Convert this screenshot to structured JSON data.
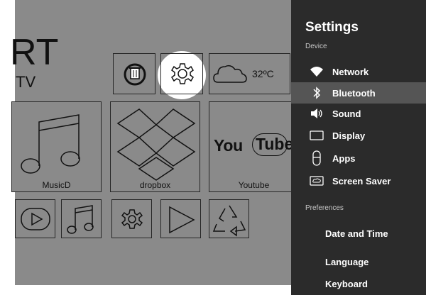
{
  "home": {
    "brand_line1": "RT",
    "brand_line2": "TV",
    "weather_temp": "32ºC",
    "tiles": {
      "music_label": "MusicD",
      "dropbox_label": "dropbox",
      "youtube_label": "Youtube",
      "youtube_logo_left": "You",
      "youtube_logo_right": "Tube"
    },
    "icons": [
      "cleaner-icon",
      "gear-icon",
      "cloud-icon",
      "music-note-icon",
      "dropbox-icon",
      "play-button-icon",
      "music-note-icon",
      "gear-icon",
      "play-store-icon",
      "recycle-icon"
    ]
  },
  "settings": {
    "title": "Settings",
    "device_header": "Device",
    "device_items": [
      {
        "label": "Network",
        "icon": "wifi-icon"
      },
      {
        "label": "Bluetooth",
        "icon": "bluetooth-icon",
        "selected": true
      },
      {
        "label": "Sound",
        "icon": "speaker-icon"
      },
      {
        "label": "Display",
        "icon": "display-icon"
      },
      {
        "label": "Apps",
        "icon": "phone-icon"
      },
      {
        "label": "Screen Saver",
        "icon": "screen-saver-icon"
      }
    ],
    "preferences_header": "Preferences",
    "preference_items": [
      {
        "label": "Date and Time"
      },
      {
        "label": "Language"
      },
      {
        "label": "Keyboard"
      }
    ]
  },
  "colors": {
    "home_overlay": "#8a8a8a",
    "panel_bg": "#2b2b2b",
    "selected_bg": "#555555",
    "outline": "#262626"
  }
}
